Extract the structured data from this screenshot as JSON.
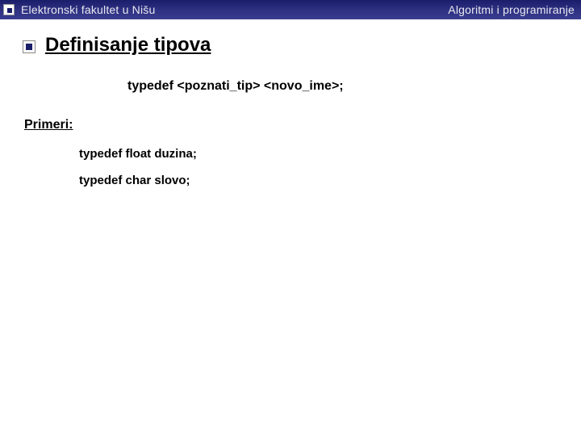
{
  "header": {
    "left": "Elektronski fakultet u Nišu",
    "right": "Algoritmi i programiranje"
  },
  "title": "Definisanje tipova",
  "syntax": "typedef <poznati_tip> <novo_ime>;",
  "subheading": "Primeri:",
  "examples": [
    "typedef float duzina;",
    "typedef char slovo;"
  ]
}
